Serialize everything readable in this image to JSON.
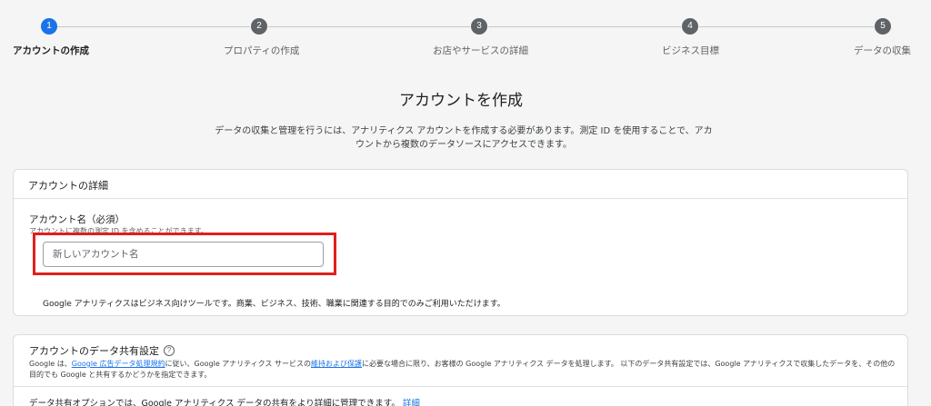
{
  "stepper": {
    "steps": [
      {
        "number": "1",
        "label": "アカウントの作成"
      },
      {
        "number": "2",
        "label": "プロパティの作成"
      },
      {
        "number": "3",
        "label": "お店やサービスの詳細"
      },
      {
        "number": "4",
        "label": "ビジネス目標"
      },
      {
        "number": "5",
        "label": "データの収集"
      }
    ],
    "active_step": 1
  },
  "header": {
    "title": "アカウントを作成",
    "description": "データの収集と管理を行うには、アナリティクス アカウントを作成する必要があります。測定 ID を使用することで、アカウントから複数のデータソースにアクセスできます。"
  },
  "account_details": {
    "title": "アカウントの詳細",
    "name_label": "アカウント名（必須）",
    "name_hint": "アカウントに複数の測定 ID を含めることができます。",
    "name_value": "",
    "name_placeholder": "新しいアカウント名",
    "notice": "Google アナリティクスはビジネス向けツールです。商業、ビジネス、技術、職業に関連する目的でのみご利用いただけます。"
  },
  "data_sharing": {
    "title": "アカウントのデータ共有設定",
    "desc_part1": "Google は、",
    "desc_link1": "Google 広告データ処理規約",
    "desc_part2": "に従い、Google アナリティクス サービスの",
    "desc_link2": "維持および保護",
    "desc_part3": "に必要な場合に限り、お客様の Google アナリティクス データを処理します。 以下のデータ共有設定では、Google アナリティクスで収集したデータを、その他の目的でも Google と共有するかどうかを指定できます。",
    "options_text": "データ共有オプションでは、Google アナリティクス データの共有をより詳細に管理できます。",
    "options_link": "詳細"
  },
  "colors": {
    "accent": "#1a73e8",
    "highlight": "#e0201b",
    "step_inactive": "#5f6368"
  }
}
